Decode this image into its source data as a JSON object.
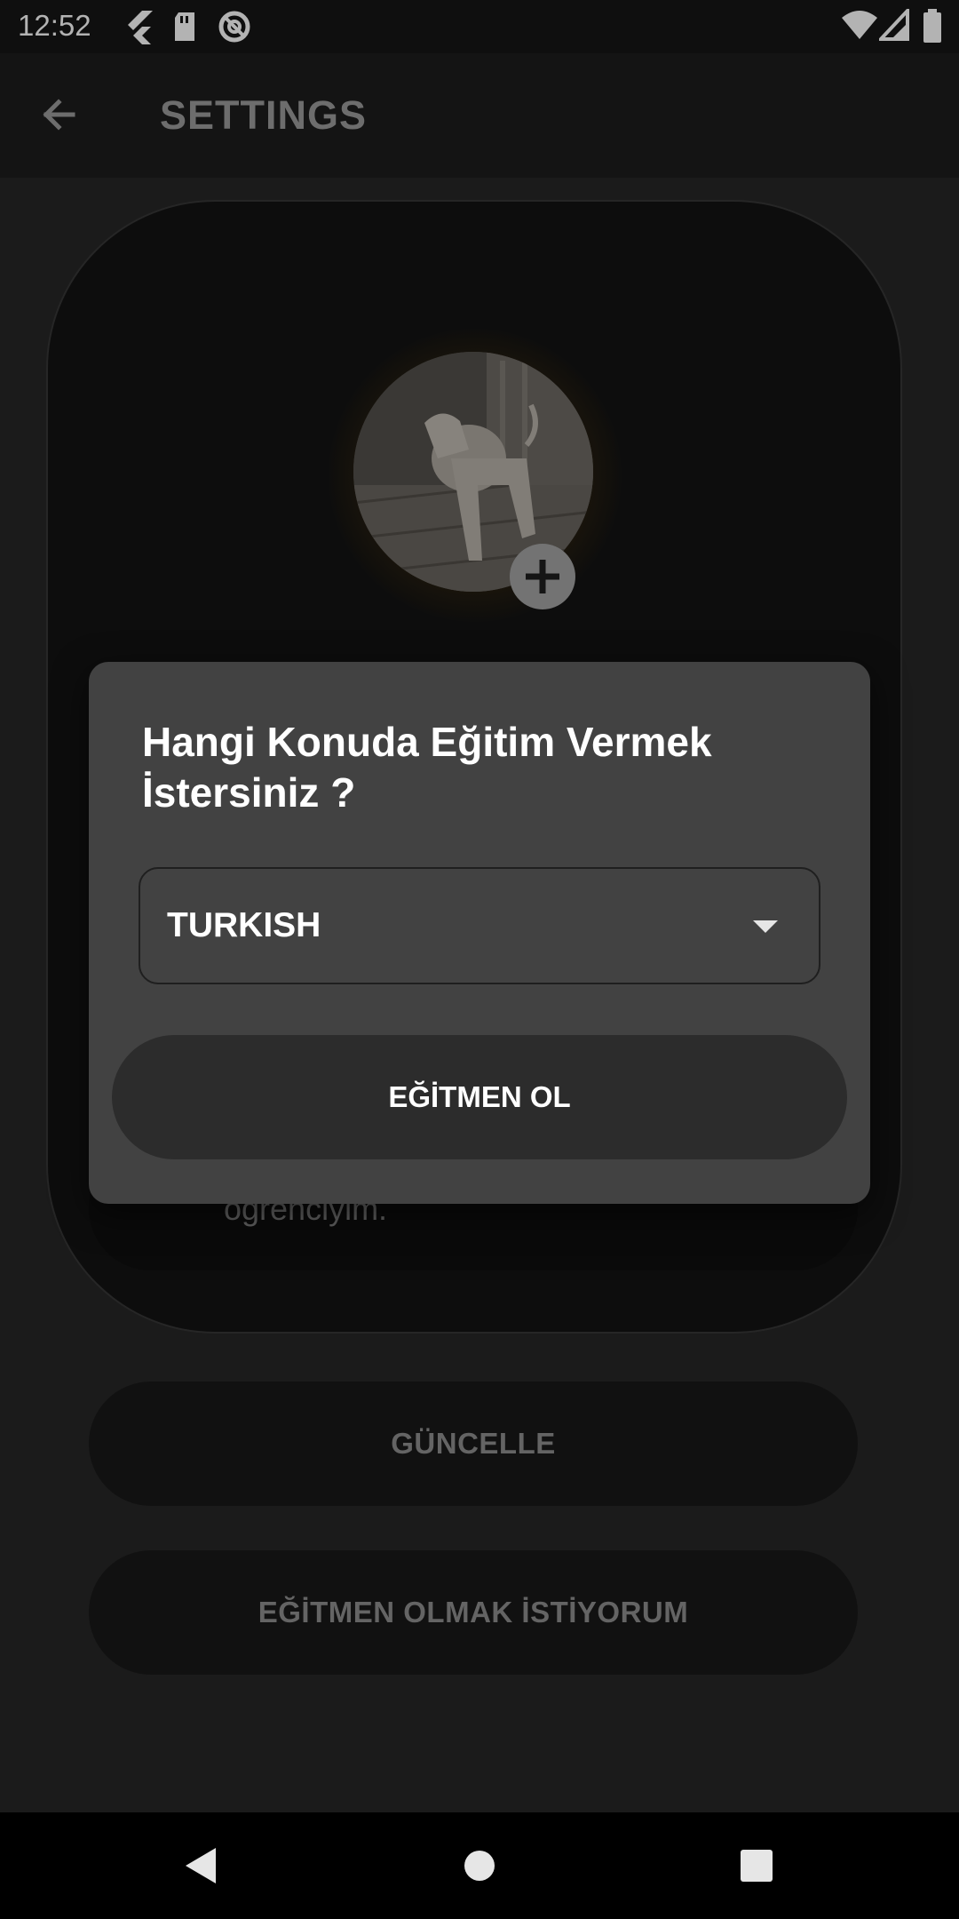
{
  "status_bar": {
    "time": "12:52",
    "icons": [
      "flutter-icon",
      "sd-card-icon",
      "at-sign-icon",
      "wifi-icon",
      "signal-icon",
      "battery-icon"
    ]
  },
  "app_bar": {
    "title": "SETTINGS",
    "back_icon": "arrow-left-icon"
  },
  "profile": {
    "bio_text": "ogrenciyim.",
    "add_photo_icon": "plus-icon"
  },
  "buttons": {
    "update": "GÜNCELLE",
    "become_trainer": "EĞİTMEN OLMAK İSTİYORUM"
  },
  "dialog": {
    "title": "Hangi Konuda Eğitim Vermek İstersiniz ?",
    "dropdown": {
      "selected": "TURKISH",
      "caret_icon": "caret-down-icon"
    },
    "confirm": "EĞİTMEN OL"
  },
  "nav_bar": {
    "icons": [
      "back-triangle-icon",
      "home-circle-icon",
      "recents-square-icon"
    ]
  },
  "colors": {
    "dialog_bg": "#424242",
    "background": "#1b1b1b",
    "avatar_glow": "#b57a12"
  }
}
